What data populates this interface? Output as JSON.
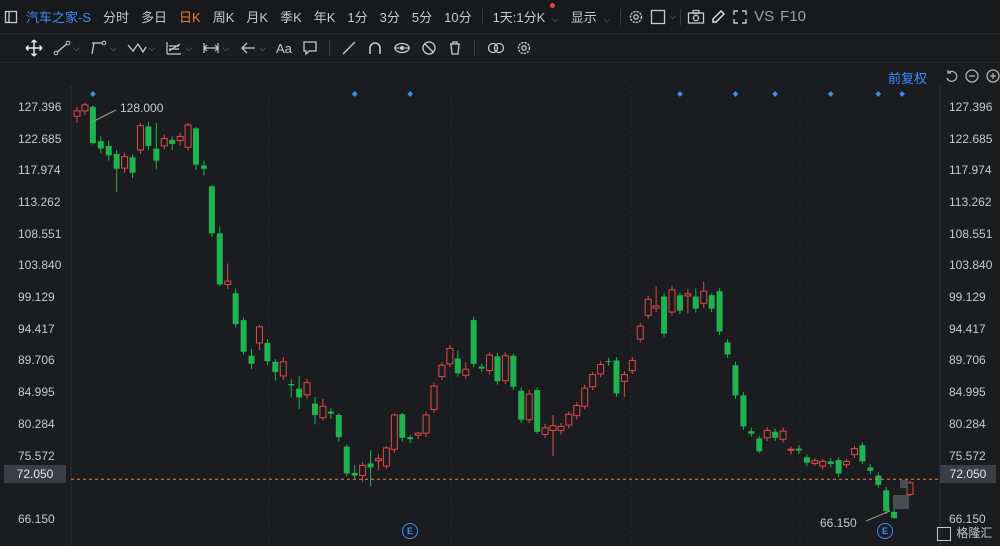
{
  "header": {
    "title": "汽车之家-S",
    "periods": [
      "分时",
      "多日",
      "日K",
      "周K",
      "月K",
      "季K",
      "年K",
      "1分",
      "3分",
      "5分",
      "10分"
    ],
    "active_period": "日K",
    "interval_select": "1天:1分K",
    "display_label": "显示",
    "vs_label": "VS",
    "f10_label": "F10"
  },
  "toolbar": {
    "font_label": "Aa"
  },
  "chart_header": {
    "adjust_label": "前复权"
  },
  "axis": {
    "left_labels": [
      "127.396",
      "122.685",
      "117.974",
      "113.262",
      "108.551",
      "103.840",
      "99.129",
      "94.417",
      "89.706",
      "84.995",
      "80.284",
      "75.572",
      "72.050",
      "66.150"
    ],
    "right_labels": [
      "127.396",
      "122.685",
      "117.974",
      "113.262",
      "108.551",
      "103.840",
      "99.129",
      "94.417",
      "89.706",
      "84.995",
      "80.284",
      "75.572",
      "66.150"
    ]
  },
  "current_price": "72.050",
  "annotations": {
    "high": "128.000",
    "low": "66.150",
    "event_badge": "E"
  },
  "watermark": "格隆汇",
  "colors": {
    "up": "#e04949",
    "down": "#1fb34f",
    "accent": "#3f8cff",
    "active": "#f07a2b"
  },
  "chart_data": {
    "type": "candlestick",
    "ylim": [
      64.5,
      130.5
    ],
    "candles": [
      [
        126.0,
        126.8,
        125.0,
        127.4
      ],
      [
        126.8,
        127.7,
        126.2,
        128.0
      ],
      [
        127.4,
        122.0,
        121.8,
        127.6
      ],
      [
        122.3,
        121.2,
        120.5,
        123.0
      ],
      [
        121.6,
        120.2,
        119.4,
        122.4
      ],
      [
        120.4,
        118.2,
        114.7,
        121.0
      ],
      [
        118.3,
        120.0,
        117.6,
        120.6
      ],
      [
        119.9,
        117.6,
        116.8,
        120.3
      ],
      [
        121.0,
        124.6,
        120.4,
        125.0
      ],
      [
        124.5,
        121.6,
        121.0,
        125.2
      ],
      [
        121.2,
        119.4,
        118.1,
        125.0
      ],
      [
        121.6,
        122.7,
        121.1,
        123.3
      ],
      [
        122.5,
        121.9,
        121.0,
        123.0
      ],
      [
        122.4,
        123.0,
        121.6,
        123.6
      ],
      [
        121.4,
        124.7,
        120.9,
        125.0
      ],
      [
        124.2,
        118.8,
        118.0,
        124.4
      ],
      [
        118.7,
        118.2,
        117.2,
        119.4
      ],
      [
        115.6,
        108.6,
        108.1,
        115.8
      ],
      [
        108.6,
        101.0,
        100.8,
        109.6
      ],
      [
        101.0,
        101.5,
        100.3,
        104.1
      ],
      [
        99.7,
        95.1,
        94.6,
        100.4
      ],
      [
        95.7,
        91.0,
        90.6,
        96.1
      ],
      [
        90.4,
        89.2,
        88.4,
        91.4
      ],
      [
        92.3,
        94.7,
        91.2,
        95.0
      ],
      [
        92.3,
        89.6,
        89.0,
        92.9
      ],
      [
        89.5,
        88.0,
        86.7,
        89.9
      ],
      [
        87.4,
        89.5,
        86.8,
        90.2
      ],
      [
        86.2,
        86.0,
        84.2,
        86.9
      ],
      [
        85.5,
        84.2,
        82.5,
        87.4
      ],
      [
        84.6,
        86.4,
        84.0,
        87.0
      ],
      [
        83.3,
        81.6,
        80.2,
        84.3
      ],
      [
        81.2,
        82.9,
        80.8,
        84.0
      ],
      [
        82.1,
        81.8,
        81.0,
        82.6
      ],
      [
        81.6,
        78.3,
        77.6,
        81.9
      ],
      [
        76.9,
        72.9,
        72.5,
        77.2
      ],
      [
        73.0,
        72.6,
        72.0,
        74.1
      ],
      [
        72.6,
        74.1,
        71.6,
        74.6
      ],
      [
        74.4,
        73.8,
        71.0,
        76.4
      ],
      [
        74.8,
        75.1,
        73.4,
        75.8
      ],
      [
        74.0,
        76.7,
        73.5,
        77.0
      ],
      [
        76.5,
        81.6,
        76.0,
        81.8
      ],
      [
        81.7,
        78.2,
        77.6,
        81.9
      ],
      [
        78.3,
        78.0,
        77.4,
        78.6
      ],
      [
        78.6,
        78.9,
        78.0,
        79.1
      ],
      [
        78.9,
        81.6,
        78.3,
        82.1
      ],
      [
        82.4,
        85.9,
        81.9,
        86.4
      ],
      [
        87.3,
        89.0,
        86.8,
        89.4
      ],
      [
        89.2,
        91.5,
        88.7,
        92.0
      ],
      [
        90.0,
        87.8,
        87.3,
        91.2
      ],
      [
        87.5,
        88.4,
        87.0,
        89.4
      ],
      [
        95.7,
        89.2,
        88.7,
        96.2
      ],
      [
        88.8,
        88.5,
        88.0,
        89.2
      ],
      [
        88.2,
        90.5,
        87.6,
        90.9
      ],
      [
        90.3,
        86.6,
        86.1,
        90.8
      ],
      [
        86.7,
        90.4,
        86.2,
        90.9
      ],
      [
        90.4,
        85.8,
        85.3,
        90.7
      ],
      [
        85.2,
        80.9,
        80.4,
        85.7
      ],
      [
        80.9,
        84.7,
        80.4,
        85.3
      ],
      [
        85.3,
        79.1,
        78.8,
        85.7
      ],
      [
        78.7,
        79.7,
        78.2,
        80.3
      ],
      [
        79.3,
        80.0,
        75.5,
        81.6
      ],
      [
        79.3,
        79.9,
        78.7,
        80.4
      ],
      [
        80.1,
        81.7,
        79.6,
        82.1
      ],
      [
        81.5,
        83.0,
        80.9,
        83.5
      ],
      [
        82.9,
        85.6,
        82.4,
        86.1
      ],
      [
        85.8,
        87.6,
        85.3,
        88.0
      ],
      [
        87.7,
        89.1,
        87.2,
        89.6
      ],
      [
        89.6,
        89.5,
        88.9,
        90.1
      ],
      [
        89.7,
        84.8,
        84.3,
        90.2
      ],
      [
        86.6,
        87.6,
        84.3,
        88.1
      ],
      [
        88.2,
        89.7,
        87.7,
        90.2
      ],
      [
        92.9,
        94.8,
        92.4,
        95.3
      ],
      [
        96.4,
        98.8,
        95.9,
        99.3
      ],
      [
        97.5,
        97.8,
        96.9,
        100.7
      ],
      [
        99.2,
        93.7,
        93.2,
        99.7
      ],
      [
        96.9,
        100.2,
        96.4,
        100.8
      ],
      [
        99.4,
        97.1,
        96.6,
        99.8
      ],
      [
        99.3,
        99.6,
        96.7,
        100.3
      ],
      [
        99.2,
        97.4,
        96.8,
        100.4
      ],
      [
        98.2,
        100.0,
        97.5,
        101.4
      ],
      [
        99.4,
        97.4,
        96.9,
        99.7
      ],
      [
        100.0,
        94.0,
        93.5,
        100.5
      ],
      [
        92.4,
        90.6,
        90.1,
        92.9
      ],
      [
        89.0,
        84.5,
        84.0,
        89.5
      ],
      [
        84.5,
        79.9,
        79.4,
        85.0
      ],
      [
        79.2,
        78.8,
        78.4,
        79.7
      ],
      [
        78.1,
        76.2,
        75.9,
        78.5
      ],
      [
        78.2,
        79.3,
        77.7,
        79.8
      ],
      [
        79.1,
        78.2,
        77.7,
        79.6
      ],
      [
        78.0,
        79.2,
        77.5,
        79.7
      ],
      [
        76.5,
        76.5,
        75.7,
        76.9
      ],
      [
        76.6,
        76.3,
        75.8,
        77.1
      ],
      [
        75.3,
        74.5,
        74.0,
        75.7
      ],
      [
        74.4,
        74.8,
        74.0,
        75.2
      ],
      [
        74.0,
        74.7,
        73.5,
        75.0
      ],
      [
        74.7,
        74.3,
        73.8,
        75.2
      ],
      [
        74.9,
        72.9,
        72.4,
        75.3
      ],
      [
        74.2,
        74.7,
        73.7,
        75.1
      ],
      [
        75.7,
        76.6,
        75.2,
        77.0
      ],
      [
        77.1,
        74.7,
        74.3,
        77.5
      ],
      [
        73.8,
        73.3,
        72.8,
        74.3
      ],
      [
        72.6,
        71.2,
        70.8,
        73.1
      ],
      [
        70.4,
        67.3,
        66.9,
        70.9
      ],
      [
        67.2,
        66.3,
        66.15,
        67.6
      ],
      [
        68.4,
        68.7,
        67.9,
        69.1
      ],
      [
        69.8,
        71.5,
        69.5,
        71.8
      ]
    ]
  }
}
